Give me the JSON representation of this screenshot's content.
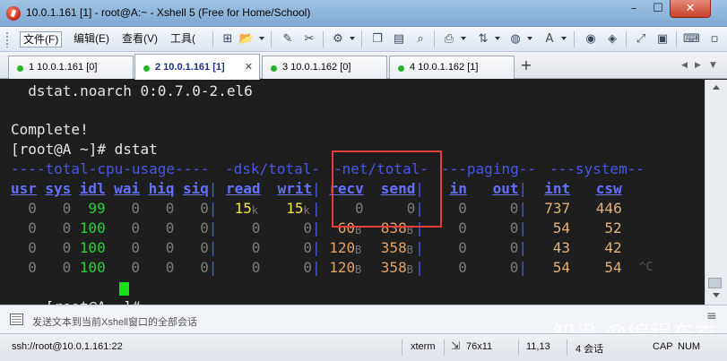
{
  "window": {
    "title": "10.0.1.161 [1] - root@A:~ - Xshell 5 (Free for Home/School)",
    "minimize": "–",
    "maximize": "☐",
    "close": "✕"
  },
  "menu": {
    "file": "文件(F)",
    "edit": "编辑(E)",
    "view": "查看(V)",
    "tools": "工具("
  },
  "toolbar_icons": [
    "new-session-icon",
    "open-folder-icon",
    "reconnect-icon",
    "disconnect-icon",
    "properties-icon",
    "copy-icon",
    "paste-icon",
    "find-icon",
    "print-icon",
    "transfer-icon",
    "globe-icon",
    "font-icon",
    "script-icon",
    "keyboard-lock-icon",
    "fullscreen-icon",
    "lock-icon",
    "keyboard-icon"
  ],
  "tabs": [
    {
      "label": "1 10.0.1.161 [0]",
      "active": false
    },
    {
      "label": "2 10.0.1.161 [1]",
      "active": true
    },
    {
      "label": "3 10.0.1.162 [0]",
      "active": false
    },
    {
      "label": "4 10.0.1.162 [1]",
      "active": false
    }
  ],
  "tab_add": "+",
  "tab_nav": {
    "prev": "◀",
    "next": "▶",
    "menu": "▼"
  },
  "terminal": {
    "line_pkg": "  dstat.noarch 0:0.7.0-2.el6",
    "line_complete": "Complete!",
    "line_cmd": "[root@A ~]# dstat",
    "groups": {
      "cpu": "----total-cpu-usage----",
      "dsk": "-dsk/total-",
      "net": "-net/total-",
      "paging": "---paging--",
      "system": "---system--"
    },
    "columns": [
      "usr",
      "sys",
      "idl",
      "wai",
      "hiq",
      "siq",
      "read",
      "writ",
      "recv",
      "send",
      "in",
      "out",
      "int",
      "csw"
    ],
    "rows": [
      {
        "usr": "0",
        "sys": "0",
        "idl": "99",
        "wai": "0",
        "hiq": "0",
        "siq": "0",
        "read": "15",
        "read_unit": "k",
        "writ": "15",
        "writ_unit": "k",
        "recv": "0",
        "recv_unit": "",
        "send": "0",
        "send_unit": "",
        "in": "0",
        "out": "0",
        "int": "737",
        "csw": "446",
        "extra": ""
      },
      {
        "usr": "0",
        "sys": "0",
        "idl": "100",
        "wai": "0",
        "hiq": "0",
        "siq": "0",
        "read": "0",
        "read_unit": "",
        "writ": "0",
        "writ_unit": "",
        "recv": "60",
        "recv_unit": "B",
        "send": "838",
        "send_unit": "B",
        "in": "0",
        "out": "0",
        "int": "54",
        "csw": "52",
        "extra": ""
      },
      {
        "usr": "0",
        "sys": "0",
        "idl": "100",
        "wai": "0",
        "hiq": "0",
        "siq": "0",
        "read": "0",
        "read_unit": "",
        "writ": "0",
        "writ_unit": "",
        "recv": "120",
        "recv_unit": "B",
        "send": "358",
        "send_unit": "B",
        "in": "0",
        "out": "0",
        "int": "43",
        "csw": "42",
        "extra": ""
      },
      {
        "usr": "0",
        "sys": "0",
        "idl": "100",
        "wai": "0",
        "hiq": "0",
        "siq": "0",
        "read": "0",
        "read_unit": "",
        "writ": "0",
        "writ_unit": "",
        "recv": "120",
        "recv_unit": "B",
        "send": "358",
        "send_unit": "B",
        "in": "0",
        "out": "0",
        "int": "54",
        "csw": "54",
        "extra": "^C"
      }
    ],
    "prompt": "[root@A ~]# "
  },
  "compose": {
    "text": "发送文本到当前Xshell窗口的全部会话",
    "menu": "≡"
  },
  "status": {
    "connection": "ssh://root@10.0.1.161:22",
    "terminal_type": "xterm",
    "size": "76x11",
    "cursor_pos": "11,13",
    "sessions": "4 会话",
    "caps": "CAP",
    "num": "NUM"
  },
  "watermark": {
    "text": "知乎 @编程布衣"
  },
  "colors": {
    "terminal_bg": "#1e1e1e",
    "header_blue": "#4857e8",
    "idl_green": "#26d03a",
    "disk_yellow": "#f0e640",
    "net_orange": "#e2a36a",
    "system_tan": "#e1b37c",
    "zero_gray": "#7c7c7c",
    "highlight_red": "#e43e3e",
    "cursor_green": "#17e017"
  }
}
